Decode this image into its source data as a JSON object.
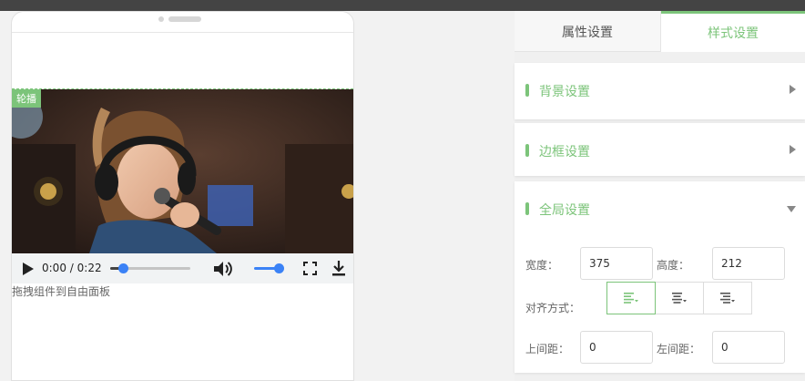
{
  "colors": {
    "accent": "#7cc47a",
    "video_knob": "#3b82f6",
    "topbar": "#444444"
  },
  "canvas": {
    "carousel_tag": "轮播",
    "video": {
      "current_time": "0:00",
      "separator": "/",
      "duration": "0:22",
      "progress_fraction": 0.16,
      "volume_fraction": 1.0
    },
    "drag_hint": "拖拽组件到自由面板"
  },
  "panel": {
    "tabs": [
      {
        "label": "属性设置",
        "active": false
      },
      {
        "label": "样式设置",
        "active": true
      }
    ],
    "sections": [
      {
        "title": "背景设置",
        "expanded": false
      },
      {
        "title": "边框设置",
        "expanded": false
      },
      {
        "title": "全局设置",
        "expanded": true
      }
    ],
    "global": {
      "width_label": "宽度：",
      "width_value": "375",
      "height_label": "高度：",
      "height_value": "212",
      "align_label": "对齐方式：",
      "align_options": [
        "align-left-icon",
        "align-center-icon",
        "align-right-icon"
      ],
      "align_selected": 0,
      "top_margin_label": "上间距：",
      "top_margin_value": "0",
      "left_margin_label": "左间距：",
      "left_margin_value": "0"
    }
  }
}
